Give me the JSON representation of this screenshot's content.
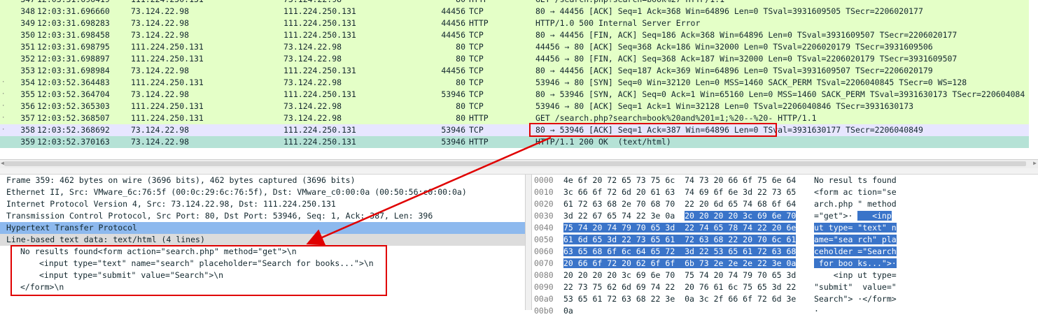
{
  "packet_list": {
    "rows": [
      {
        "no": "347",
        "time": "12:03:31.696419",
        "src": "111.224.250.131",
        "dst": "73.124.22.98",
        "port": "80",
        "proto": "HTTP",
        "info": "GET /search.php?search=book%27 HTTP/1.1",
        "kind": "http"
      },
      {
        "no": "348",
        "time": "12:03:31.696660",
        "src": "73.124.22.98",
        "dst": "111.224.250.131",
        "port": "44456",
        "proto": "TCP",
        "info": "80 → 44456 [ACK] Seq=1 Ack=368 Win=64896 Len=0 TSval=3931609505 TSecr=2206020177",
        "kind": "http"
      },
      {
        "no": "349",
        "time": "12:03:31.698283",
        "src": "73.124.22.98",
        "dst": "111.224.250.131",
        "port": "44456",
        "proto": "HTTP",
        "info": "HTTP/1.0 500 Internal Server Error",
        "kind": "http"
      },
      {
        "no": "350",
        "time": "12:03:31.698458",
        "src": "73.124.22.98",
        "dst": "111.224.250.131",
        "port": "44456",
        "proto": "TCP",
        "info": "80 → 44456 [FIN, ACK] Seq=186 Ack=368 Win=64896 Len=0 TSval=3931609507 TSecr=2206020177",
        "kind": "http"
      },
      {
        "no": "351",
        "time": "12:03:31.698795",
        "src": "111.224.250.131",
        "dst": "73.124.22.98",
        "port": "80",
        "proto": "TCP",
        "info": "44456 → 80 [ACK] Seq=368 Ack=186 Win=32000 Len=0 TSval=2206020179 TSecr=3931609506",
        "kind": "http"
      },
      {
        "no": "352",
        "time": "12:03:31.698897",
        "src": "111.224.250.131",
        "dst": "73.124.22.98",
        "port": "80",
        "proto": "TCP",
        "info": "44456 → 80 [FIN, ACK] Seq=368 Ack=187 Win=32000 Len=0 TSval=2206020179 TSecr=3931609507",
        "kind": "http"
      },
      {
        "no": "353",
        "time": "12:03:31.698984",
        "src": "73.124.22.98",
        "dst": "111.224.250.131",
        "port": "44456",
        "proto": "TCP",
        "info": "80 → 44456 [ACK] Seq=187 Ack=369 Win=64896 Len=0 TSval=3931609507 TSecr=2206020179",
        "kind": "http"
      },
      {
        "no": "354",
        "time": "12:03:52.364483",
        "src": "111.224.250.131",
        "dst": "73.124.22.98",
        "port": "80",
        "proto": "TCP",
        "info": "53946 → 80 [SYN] Seq=0 Win=32120 Len=0 MSS=1460 SACK_PERM TSval=2206040845 TSecr=0 WS=128",
        "kind": "http"
      },
      {
        "no": "355",
        "time": "12:03:52.364704",
        "src": "73.124.22.98",
        "dst": "111.224.250.131",
        "port": "53946",
        "proto": "TCP",
        "info": "80 → 53946 [SYN, ACK] Seq=0 Ack=1 Win=65160 Len=0 MSS=1460 SACK_PERM TSval=3931630173 TSecr=220604084",
        "kind": "http"
      },
      {
        "no": "356",
        "time": "12:03:52.365303",
        "src": "111.224.250.131",
        "dst": "73.124.22.98",
        "port": "80",
        "proto": "TCP",
        "info": "53946 → 80 [ACK] Seq=1 Ack=1 Win=32128 Len=0 TSval=2206040846 TSecr=3931630173",
        "kind": "http"
      },
      {
        "no": "357",
        "time": "12:03:52.368507",
        "src": "111.224.250.131",
        "dst": "73.124.22.98",
        "port": "80",
        "proto": "HTTP",
        "info": "GET /search.php?search=book%20and%201=1;%20--%20- HTTP/1.1",
        "kind": "http"
      },
      {
        "no": "358",
        "time": "12:03:52.368692",
        "src": "73.124.22.98",
        "dst": "111.224.250.131",
        "port": "53946",
        "proto": "TCP",
        "info": "80 → 53946 [ACK] Seq=1 Ack=387 Win=64896 Len=0 TSval=3931630177 TSecr=2206040849",
        "kind": "tcp"
      },
      {
        "no": "359",
        "time": "12:03:52.370163",
        "src": "73.124.22.98",
        "dst": "111.224.250.131",
        "port": "53946",
        "proto": "HTTP",
        "info": "HTTP/1.1 200 OK  (text/html)",
        "kind": "selected"
      }
    ]
  },
  "details": {
    "lines": [
      "Frame 359: 462 bytes on wire (3696 bits), 462 bytes captured (3696 bits)",
      "Ethernet II, Src: VMware_6c:76:5f (00:0c:29:6c:76:5f), Dst: VMware_c0:00:0a (00:50:56:c0:00:0a)",
      "Internet Protocol Version 4, Src: 73.124.22.98, Dst: 111.224.250.131",
      "Transmission Control Protocol, Src Port: 80, Dst Port: 53946, Seq: 1, Ack: 387, Len: 396",
      "Hypertext Transfer Protocol",
      "Line-based text data: text/html (4 lines)",
      "No results found<form action=\"search.php\" method=\"get\">\\n",
      "<input type=\"text\" name=\"search\" placeholder=\"Search for books...\">\\n",
      "<input type=\"submit\" value=\"Search\">\\n",
      "</form>\\n"
    ]
  },
  "bytes": {
    "rows": [
      {
        "off": "0000",
        "hex_a": "4e 6f 20 72 65 73 75 6c  74 73 20 66 6f 75 6e 64",
        "hex_b": "",
        "asc_a": "No resul ts found",
        "asc_b": ""
      },
      {
        "off": "0010",
        "hex_a": "3c 66 6f 72 6d 20 61 63  74 69 6f 6e 3d 22 73 65",
        "hex_b": "",
        "asc_a": "<form ac tion=\"se",
        "asc_b": ""
      },
      {
        "off": "0020",
        "hex_a": "61 72 63 68 2e 70 68 70  22 20 6d 65 74 68 6f 64",
        "hex_b": "",
        "asc_a": "arch.php \" method",
        "asc_b": ""
      },
      {
        "off": "0030",
        "hex_a": "3d 22 67 65 74 22 3e 0a  ",
        "hex_b": "20 20 20 20 3c 69 6e 70",
        "asc_a": "=\"get\">· ",
        "asc_b": "   <inp"
      },
      {
        "off": "0040",
        "hex_a": "",
        "hex_b": "75 74 20 74 79 70 65 3d  22 74 65 78 74 22 20 6e",
        "asc_a": "",
        "asc_b": "ut type= \"text\" n"
      },
      {
        "off": "0050",
        "hex_a": "",
        "hex_b": "61 6d 65 3d 22 73 65 61  72 63 68 22 20 70 6c 61",
        "asc_a": "",
        "asc_b": "ame=\"sea rch\" pla"
      },
      {
        "off": "0060",
        "hex_a": "",
        "hex_b": "63 65 68 6f 6c 64 65 72  3d 22 53 65 61 72 63 68",
        "asc_a": "",
        "asc_b": "ceholder =\"Search"
      },
      {
        "off": "0070",
        "hex_a": "",
        "hex_b": "20 66 6f 72 20 62 6f 6f  6b 73 2e 2e 2e 22 3e 0a",
        "asc_a": "",
        "asc_b": " for boo ks...\">·"
      },
      {
        "off": "0080",
        "hex_a": "20 20 20 20 3c 69 6e 70  75 74 20 74 79 70 65 3d",
        "hex_b": "",
        "asc_a": "    <inp ut type=",
        "asc_b": ""
      },
      {
        "off": "0090",
        "hex_a": "22 73 75 62 6d 69 74 22  20 76 61 6c 75 65 3d 22",
        "hex_b": "",
        "asc_a": "\"submit\"  value=\"",
        "asc_b": ""
      },
      {
        "off": "00a0",
        "hex_a": "53 65 61 72 63 68 22 3e  0a 3c 2f 66 6f 72 6d 3e",
        "hex_b": "",
        "asc_a": "Search\"> ·</form>",
        "asc_b": ""
      },
      {
        "off": "00b0",
        "hex_a": "0a",
        "hex_b": "",
        "asc_a": "·",
        "asc_b": ""
      }
    ]
  }
}
